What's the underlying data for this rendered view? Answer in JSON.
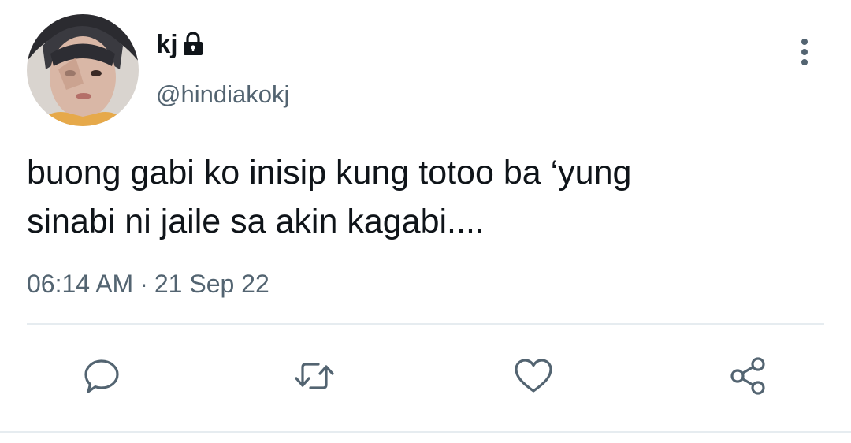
{
  "tweet": {
    "author": {
      "display_name": "kj",
      "handle": "@hindiakokj",
      "protected_icon": "lock-icon",
      "avatar_icon": "profile-photo"
    },
    "text": "buong gabi ko inisip kung totoo ba ‘yung\nsinabi ni jaile sa akin kagabi....",
    "time": "06:14 AM",
    "separator": "·",
    "date": "21 Sep 22",
    "menu_icon": "more-vertical-icon",
    "actions": {
      "reply_icon": "reply-icon",
      "retweet_icon": "retweet-icon",
      "like_icon": "heart-icon",
      "share_icon": "share-icon"
    }
  },
  "colors": {
    "primary_text": "#0f1419",
    "secondary_text": "#536471",
    "icon": "#536471",
    "divider": "#e6ecf0",
    "background": "#ffffff"
  }
}
